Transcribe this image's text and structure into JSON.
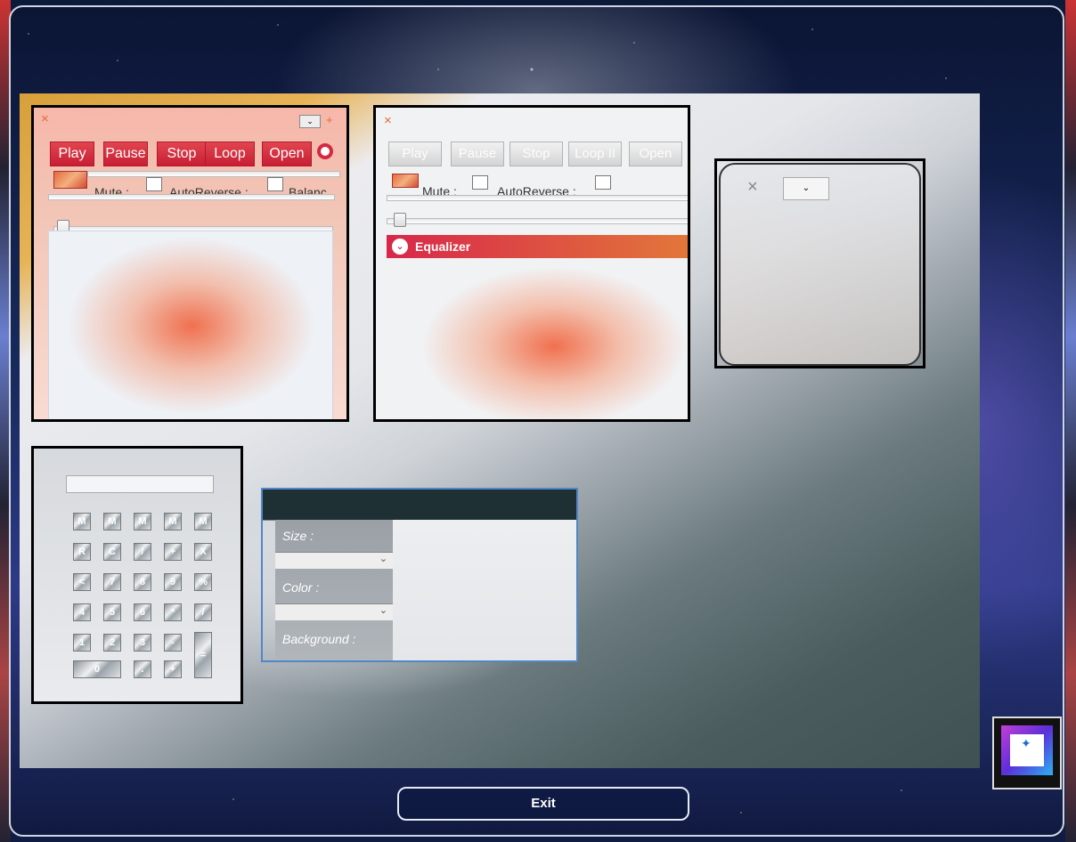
{
  "player_window_1": {
    "close_glyph": "×",
    "buttons": {
      "play": "Play",
      "pause": "Pause",
      "stop": "Stop",
      "loop": "Loop",
      "open": "Open"
    },
    "mute_label": "Mute :",
    "autoreverse_label": "AutoReverse :",
    "balance_label": "Balanc"
  },
  "player_window_2": {
    "close_glyph": "×",
    "buttons": {
      "play": "Play",
      "pause": "Pause",
      "stop": "Stop",
      "loop": "Loop II",
      "open": "Open"
    },
    "mute_label": "Mute :",
    "autoreverse_label": "AutoReverse :",
    "equalizer_label": "Equalizer"
  },
  "small_window": {
    "close_glyph": "×"
  },
  "font_panel": {
    "size_label": "Size :",
    "color_label": "Color :",
    "background_label": "Background :"
  },
  "calculator": {
    "keys_row1": [
      "M",
      "M",
      "M",
      "M",
      "M"
    ],
    "keys_row2": [
      "R",
      "C",
      "/",
      "+",
      "X"
    ],
    "keys_row3": [
      "<",
      "7",
      "8",
      "9",
      "%"
    ],
    "keys_row4": [
      "4",
      "5",
      "6",
      "*",
      "/"
    ],
    "keys_row5": [
      "1",
      "2",
      "3",
      "-",
      "="
    ],
    "keys_row6": [
      "0",
      ".",
      "+"
    ]
  },
  "exit_label": "Exit",
  "colors": {
    "accent_red": "#d42a3f",
    "equalizer_orange": "#e2773a",
    "gold": "#d8a03a"
  }
}
